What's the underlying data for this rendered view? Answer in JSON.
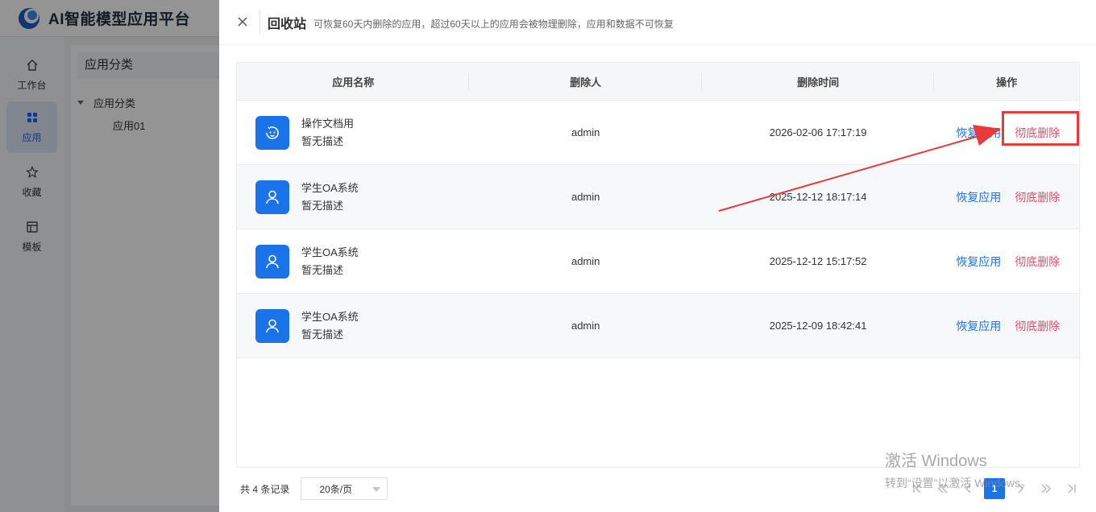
{
  "app": {
    "title": "AI智能模型应用平台",
    "brand_color": "#1664ff"
  },
  "nav": {
    "items": [
      {
        "label": "工作台",
        "icon": "home-icon"
      },
      {
        "label": "应用",
        "icon": "grid-icon",
        "active": true
      },
      {
        "label": "收藏",
        "icon": "star-icon"
      },
      {
        "label": "模板",
        "icon": "template-icon"
      }
    ]
  },
  "category_panel": {
    "header": "应用分类",
    "tree_root": "应用分类",
    "tree_child": "应用01"
  },
  "drawer": {
    "title": "回收站",
    "subtitle": "可恢复60天内删除的应用，超过60天以上的应用会被物理删除，应用和数据不可恢复",
    "columns": [
      "应用名称",
      "删除人",
      "删除时间",
      "操作"
    ],
    "rows": [
      {
        "icon": "robot-face-icon",
        "name": "操作文档用",
        "desc": "暂无描述",
        "deleter": "admin",
        "time": "2026-02-06 17:17:19",
        "restore": "恢复应用",
        "purge": "彻底删除"
      },
      {
        "icon": "user-icon",
        "name": "学生OA系统",
        "desc": "暂无描述",
        "deleter": "admin",
        "time": "2025-12-12 18:17:14",
        "restore": "恢复应用",
        "purge": "彻底删除"
      },
      {
        "icon": "user-icon",
        "name": "学生OA系统",
        "desc": "暂无描述",
        "deleter": "admin",
        "time": "2025-12-12 15:17:52",
        "restore": "恢复应用",
        "purge": "彻底删除"
      },
      {
        "icon": "user-icon",
        "name": "学生OA系统",
        "desc": "暂无描述",
        "deleter": "admin",
        "time": "2025-12-09 18:42:41",
        "restore": "恢复应用",
        "purge": "彻底删除"
      }
    ],
    "footer": {
      "total": "共 4 条记录",
      "page_size": "20条/页",
      "current_page": "1"
    }
  },
  "watermark": {
    "line1": "激活 Windows",
    "line2": "转到“设置”以激活 Windows。"
  },
  "colors": {
    "restore": "#1a73e8",
    "purge": "#f04864",
    "annotation": "#e83a3a"
  }
}
